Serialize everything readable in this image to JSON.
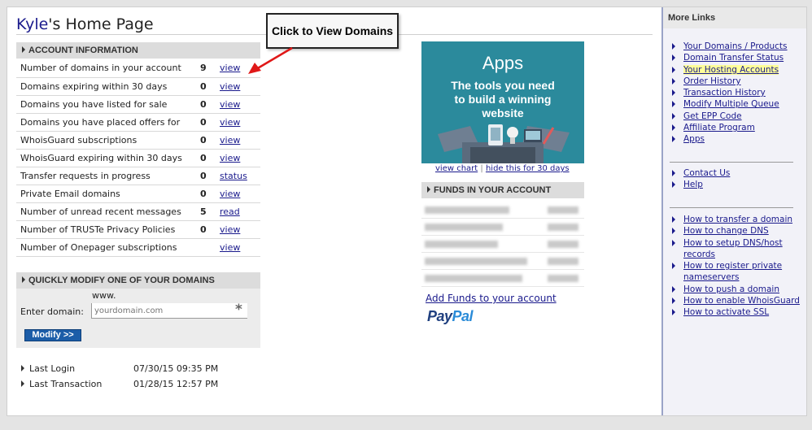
{
  "page": {
    "title_name": "Kyle",
    "title_rest": "'s Home Page"
  },
  "callout": {
    "text": "Click to View Domains"
  },
  "account": {
    "header": "ACCOUNT INFORMATION",
    "rows": [
      {
        "label": "Number of domains in your account",
        "count": "9",
        "action": "view"
      },
      {
        "label": "Domains expiring within 30 days",
        "count": "0",
        "action": "view"
      },
      {
        "label": "Domains you have listed for sale",
        "count": "0",
        "action": "view"
      },
      {
        "label": "Domains you have placed offers for",
        "count": "0",
        "action": "view"
      },
      {
        "label": "WhoisGuard subscriptions",
        "count": "0",
        "action": "view"
      },
      {
        "label": "WhoisGuard expiring within 30 days",
        "count": "0",
        "action": "view"
      },
      {
        "label": "Transfer requests in progress",
        "count": "0",
        "action": "status"
      },
      {
        "label": "Private Email domains",
        "count": "0",
        "action": "view"
      },
      {
        "label": "Number of unread recent messages",
        "count": "5",
        "action": "read"
      },
      {
        "label": "Number of TRUSTe Privacy Policies",
        "count": "0",
        "action": "view"
      },
      {
        "label": "Number of Onepager subscriptions",
        "count": "",
        "action": "view"
      }
    ]
  },
  "quick_modify": {
    "header": "QUICKLY MODIFY ONE OF YOUR DOMAINS",
    "prefix": "www.",
    "label": "Enter domain:",
    "placeholder": "yourdomain.com",
    "required_mark": "*",
    "button": "Modify >>"
  },
  "stats": {
    "last_login_label": "Last Login",
    "last_login_value": "07/30/15 09:35 PM",
    "last_transaction_label": "Last Transaction",
    "last_transaction_value": "01/28/15 12:57 PM"
  },
  "ad": {
    "title": "Apps",
    "subtitle_1": "The tools you need",
    "subtitle_2": "to build a winning",
    "subtitle_3": "website",
    "link_view": "view chart",
    "separator": "|",
    "link_hide": "hide this for 30 days",
    "bg_color": "#2b8a9c"
  },
  "funds": {
    "header": "FUNDS IN YOUR ACCOUNT",
    "add_funds": "Add Funds to your account",
    "paypal_a": "Pay",
    "paypal_b": "Pal"
  },
  "sidebar": {
    "header": "More Links",
    "group1": [
      "Your Domains / Products",
      "Domain Transfer Status",
      "Your Hosting Accounts",
      "Order History",
      "Transaction History",
      "Modify Multiple Queue",
      "Get EPP Code",
      "Affiliate Program",
      "Apps"
    ],
    "group2": [
      "Contact Us",
      "Help"
    ],
    "group3": [
      "How to transfer a domain",
      "How to change DNS",
      "How to setup DNS/host records",
      "How to register private nameservers",
      "How to push a domain",
      "How to enable WhoisGuard",
      "How to activate SSL"
    ]
  }
}
